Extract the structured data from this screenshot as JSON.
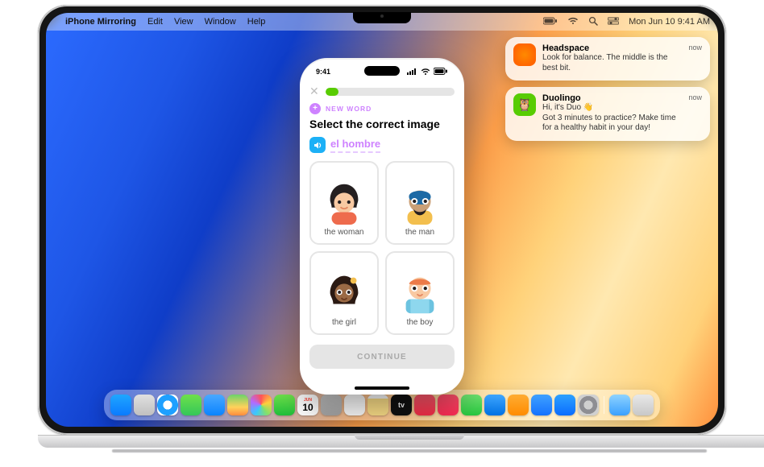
{
  "menubar": {
    "app_name": "iPhone Mirroring",
    "items": [
      "Edit",
      "View",
      "Window",
      "Help"
    ],
    "clock": "Mon Jun 10  9:41 AM"
  },
  "notifications": [
    {
      "app": "Headspace",
      "time": "now",
      "body": "Look for balance. The middle is the best bit.",
      "icon": "headspace"
    },
    {
      "app": "Duolingo",
      "time": "now",
      "body": "Hi, it's Duo 👋\nGot 3 minutes to practice? Make time for a healthy habit in your day!",
      "icon": "duolingo"
    }
  ],
  "dock": {
    "calendar": {
      "month": "JUN",
      "day": "10"
    },
    "tv_label": "tv"
  },
  "phone": {
    "clock": "9:41",
    "new_word_label": "NEW WORD",
    "prompt": "Select the correct image",
    "audio_word": "el hombre",
    "options": [
      {
        "caption": "the woman"
      },
      {
        "caption": "the man"
      },
      {
        "caption": "the girl"
      },
      {
        "caption": "the boy"
      }
    ],
    "continue_label": "CONTINUE"
  }
}
